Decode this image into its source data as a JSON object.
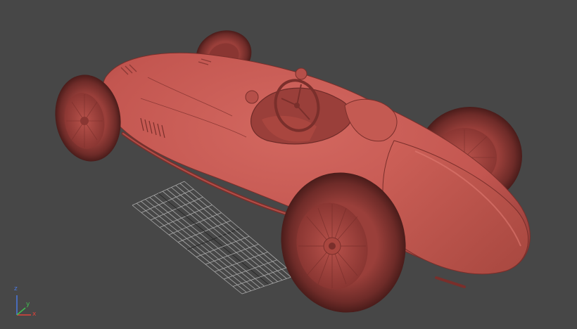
{
  "viewport": {
    "background": "#474747",
    "model_color": "#c85a52",
    "model_shadow": "#8e3a36",
    "model_dark": "#5e2624",
    "grid_color": "#bdbdbd"
  },
  "axis_gizmo": {
    "x_label": "x",
    "y_label": "y",
    "z_label": "z",
    "x_color": "#e0433a",
    "y_color": "#3fbf4f",
    "z_color": "#4a78e0"
  }
}
